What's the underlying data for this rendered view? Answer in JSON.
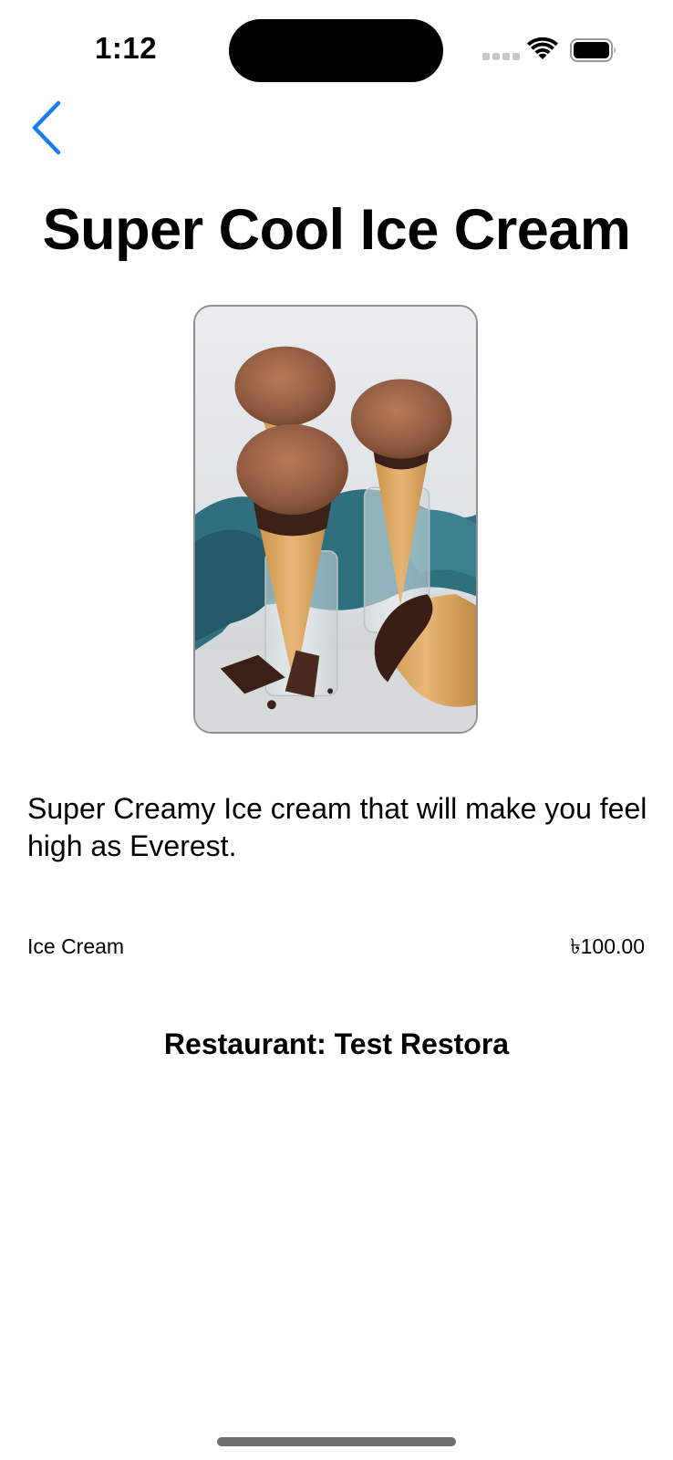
{
  "status_bar": {
    "time": "1:12"
  },
  "nav": {
    "back_icon": "chevron-left-icon"
  },
  "product": {
    "title": "Super Cool Ice Cream",
    "image_icon": "ice-cream-photo",
    "description": "Super Creamy Ice cream that will make you feel high as Everest.",
    "category": "Ice Cream",
    "price": "৳100.00",
    "restaurant": "Restaurant: Test Restora"
  },
  "colors": {
    "accent": "#1a7cf5",
    "image_border": "#8e8e93"
  }
}
